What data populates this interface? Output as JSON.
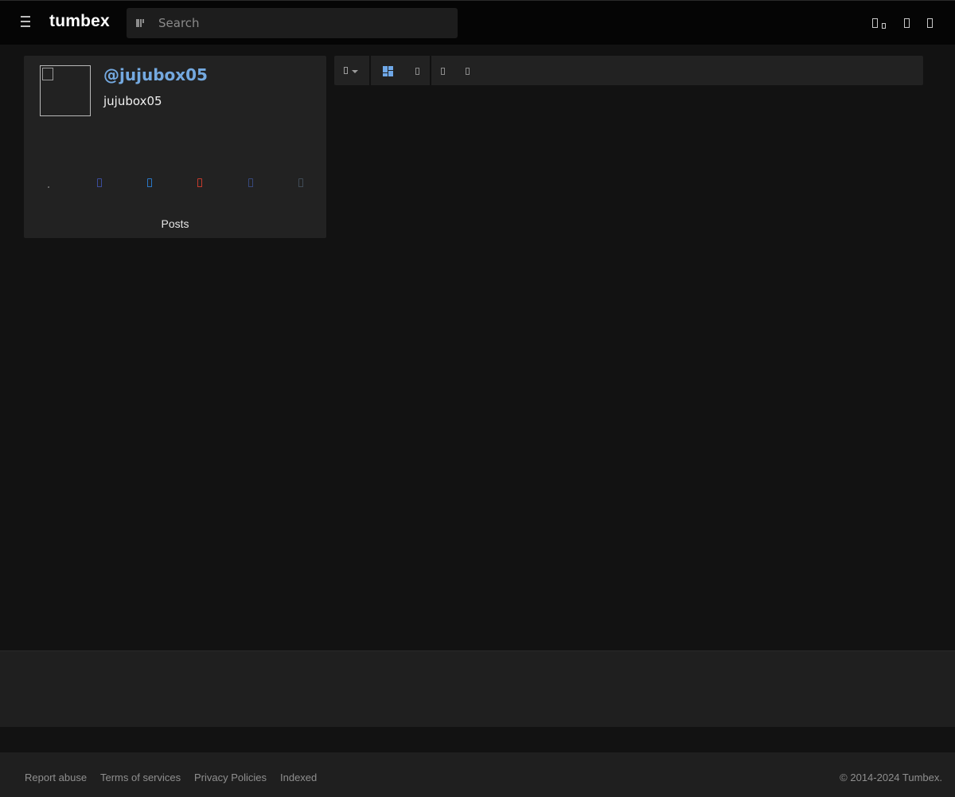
{
  "header": {
    "brand": "tumbex",
    "search_placeholder": "Search"
  },
  "profile": {
    "handle": "@jujubox05",
    "display_name": "jujubox05",
    "posts_label": "Posts",
    "share_icons": [
      {
        "name": "dot-icon",
        "color": "#6a6a6a"
      },
      {
        "name": "facebook-icon",
        "color": "#3b4c9a"
      },
      {
        "name": "twitter-icon",
        "color": "#2a76c4"
      },
      {
        "name": "pinterest-icon",
        "color": "#c23a2c"
      },
      {
        "name": "tumblr-icon",
        "color": "#37487a"
      },
      {
        "name": "link-icon",
        "color": "#3f4a55"
      }
    ]
  },
  "footer": {
    "links": [
      "Report abuse",
      "Terms of services",
      "Privacy Policies",
      "Indexed"
    ],
    "copyright": "© 2014-2024 Tumbex."
  },
  "colors": {
    "accent": "#74a9e0",
    "background": "#121212",
    "card": "#222222"
  }
}
